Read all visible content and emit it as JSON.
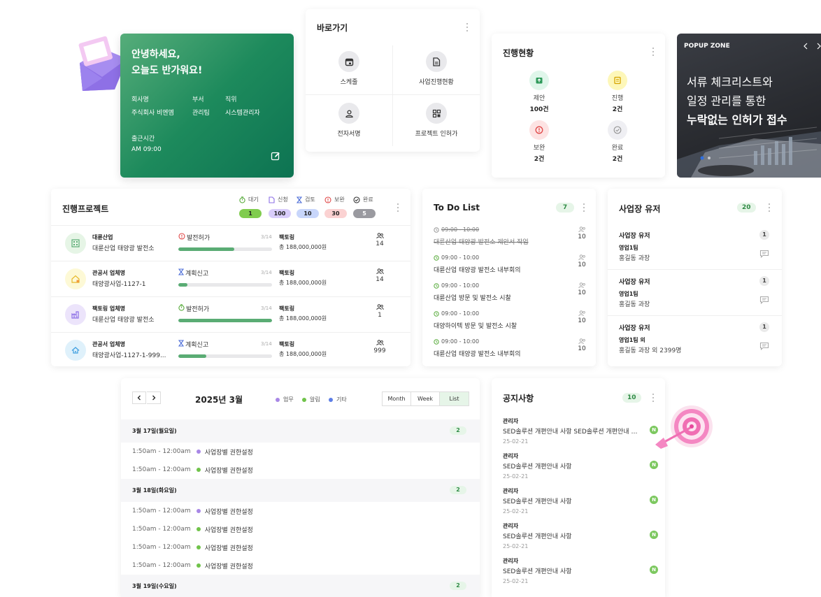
{
  "welcome": {
    "greeting_line1": "안녕하세요,",
    "greeting_line2": "오늘도 반가워요!",
    "company_label": "회사명",
    "company_value": "주식회사 비엔엠",
    "dept_label": "부서",
    "dept_value": "관리팀",
    "position_label": "직위",
    "position_value": "시스템관리자",
    "checkin_label": "출근시간",
    "checkin_value": "AM 09:00"
  },
  "shortcut": {
    "title": "바로가기",
    "items": [
      {
        "label": "스케줄",
        "icon": "calendar-icon"
      },
      {
        "label": "사업진행현황",
        "icon": "document-icon"
      },
      {
        "label": "전자서명",
        "icon": "person-icon"
      },
      {
        "label": "프로젝트 인허가",
        "icon": "grid-icon"
      }
    ]
  },
  "status": {
    "title": "진행현황",
    "items": [
      {
        "label": "제안",
        "value": "100건",
        "color": "#dff6ea",
        "icon": "proposal-icon"
      },
      {
        "label": "진행",
        "value": "2건",
        "color": "#fdf7b9",
        "icon": "progress-icon"
      },
      {
        "label": "보완",
        "value": "2건",
        "color": "#fde3e3",
        "icon": "alert-icon"
      },
      {
        "label": "완료",
        "value": "2건",
        "color": "#efeff3",
        "icon": "check-icon"
      }
    ]
  },
  "popup": {
    "zone_label": "POPUP ZONE",
    "headline_line1": "서류 체크리스트와",
    "headline_line2": "일정 관리를 통한",
    "headline_line3": "누락없는 인허가 접수"
  },
  "projects": {
    "title": "진행프로젝트",
    "legend": [
      {
        "label": "대기",
        "count": "1",
        "color": "#80cc4e",
        "icon": "timer-icon"
      },
      {
        "label": "신청",
        "count": "100",
        "color": "#d9cdfb",
        "icon": "file-icon"
      },
      {
        "label": "검토",
        "count": "10",
        "color": "#c8d6fb",
        "icon": "hourglass-icon"
      },
      {
        "label": "보완",
        "count": "30",
        "color": "#fbd2d2",
        "icon": "alert-icon"
      },
      {
        "label": "완료",
        "count": "5",
        "color": "#9a9aa0",
        "icon": "check-icon"
      }
    ],
    "rows": [
      {
        "company": "대륜산업",
        "project": "대륜산업 태양광 발전소",
        "status": "발전허가",
        "status_icon": "alert-icon",
        "status_color": "#e04848",
        "fraction": "3/14",
        "team": "팩토링",
        "amount": "총 188,000,000원",
        "people": "14",
        "progress": 0.6,
        "avatar_bg": "#e6f5e6",
        "avatar_icon": "building-icon"
      },
      {
        "company": "관공서 업체명",
        "project": "태양광사업-1127-1",
        "status": "계획신고",
        "status_icon": "hourglass-icon",
        "status_color": "#4f6fd8",
        "fraction": "3/14",
        "team": "팩토링",
        "amount": "총 188,000,000원",
        "people": "14",
        "progress": 0.1,
        "avatar_bg": "#fdf9d6",
        "avatar_icon": "house-icon"
      },
      {
        "company": "팩토링 업체명",
        "project": "대륜산업 태양광 발전소",
        "status": "발전허가",
        "status_icon": "timer-icon",
        "status_color": "#5aac3e",
        "fraction": "3/14",
        "team": "팩토링",
        "amount": "총 188,000,000원",
        "people": "1",
        "progress": 1.0,
        "avatar_bg": "#ece4fb",
        "avatar_icon": "factory-icon"
      },
      {
        "company": "관공서 업체명",
        "project": "태양광사업-1127-1-999...",
        "status": "계획신고",
        "status_icon": "hourglass-icon",
        "status_color": "#4f6fd8",
        "fraction": "3/14",
        "team": "팩토링",
        "amount": "총 188,000,000원",
        "people": "999",
        "progress": 0.3,
        "avatar_bg": "#dff1fb",
        "avatar_icon": "home-icon"
      }
    ]
  },
  "todo": {
    "title": "To Do List",
    "count": "7",
    "items": [
      {
        "time": "09:00 - 10:00",
        "text": "대륜산업 태양광 발전소 제안서 작업",
        "people": "10",
        "done": true
      },
      {
        "time": "09:00 - 10:00",
        "text": "대륜산업 태양광 발전소 내부회의",
        "people": "10",
        "done": false
      },
      {
        "time": "09:00 - 10:00",
        "text": "대륜산업 방문 및 발전소 시찰",
        "people": "10",
        "done": false
      },
      {
        "time": "09:00 - 10:00",
        "text": "대양하이텍 방문 및 발전소 시찰",
        "people": "10",
        "done": false
      },
      {
        "time": "09:00 - 10:00",
        "text": "대륜산업 태양광 발전소 내부회의",
        "people": "10",
        "done": false
      }
    ]
  },
  "users": {
    "title": "사업장 유저",
    "count": "20",
    "groups": [
      {
        "title": "사업장 유저",
        "num": "1",
        "team": "영업1팀",
        "person": "홍길동 과장"
      },
      {
        "title": "사업장 유저",
        "num": "1",
        "team": "영업1팀",
        "person": "홍길동 과장"
      },
      {
        "title": "사업장 유저",
        "num": "1",
        "team": "영업1팀 외",
        "person": "홍길동 과장 외 2399명"
      }
    ]
  },
  "calendar": {
    "month": "2025년 3월",
    "legend": [
      {
        "label": "업무",
        "color": "#a887e6"
      },
      {
        "label": "알림",
        "color": "#70c34a"
      },
      {
        "label": "기타",
        "color": "#5d7ee6"
      }
    ],
    "views": [
      "Month",
      "Week",
      "List"
    ],
    "days": [
      {
        "date": "3월 17일(월요일)",
        "count": "2",
        "events": [
          {
            "time": "1:50am - 12:00am",
            "name": "사업장별 권한설정",
            "color": "#a887e6"
          },
          {
            "time": "1:50am - 12:00am",
            "name": "사업장별 권한설정",
            "color": "#70c34a"
          }
        ]
      },
      {
        "date": "3월 18일(화요일)",
        "count": "2",
        "events": [
          {
            "time": "1:50am - 12:00am",
            "name": "사업장별 권한설정",
            "color": "#a887e6"
          },
          {
            "time": "1:50am - 12:00am",
            "name": "사업장별 권한설정",
            "color": "#70c34a"
          },
          {
            "time": "1:50am - 12:00am",
            "name": "사업장별 권한설정",
            "color": "#70c34a"
          },
          {
            "time": "1:50am - 12:00am",
            "name": "사업장별 권한설정",
            "color": "#70c34a"
          }
        ]
      },
      {
        "date": "3월 19일(수요일)",
        "count": "2",
        "events": []
      }
    ]
  },
  "notices": {
    "title": "공지사항",
    "count": "10",
    "items": [
      {
        "author": "관리자",
        "title": "SED솔루션 개편안내 사항 SED솔루션 개편안내 사항",
        "date": "25-02-21",
        "badge": "N"
      },
      {
        "author": "관리자",
        "title": "SED솔루션 개편안내 사항",
        "date": "25-02-21",
        "badge": "N"
      },
      {
        "author": "관리자",
        "title": "SED솔루션 개편안내 사항",
        "date": "25-02-21",
        "badge": "N"
      },
      {
        "author": "관리자",
        "title": "SED솔루션 개편안내 사항",
        "date": "25-02-21",
        "badge": "N"
      },
      {
        "author": "관리자",
        "title": "SED솔루션 개편안내 사항",
        "date": "25-02-21",
        "badge": "N"
      }
    ]
  }
}
